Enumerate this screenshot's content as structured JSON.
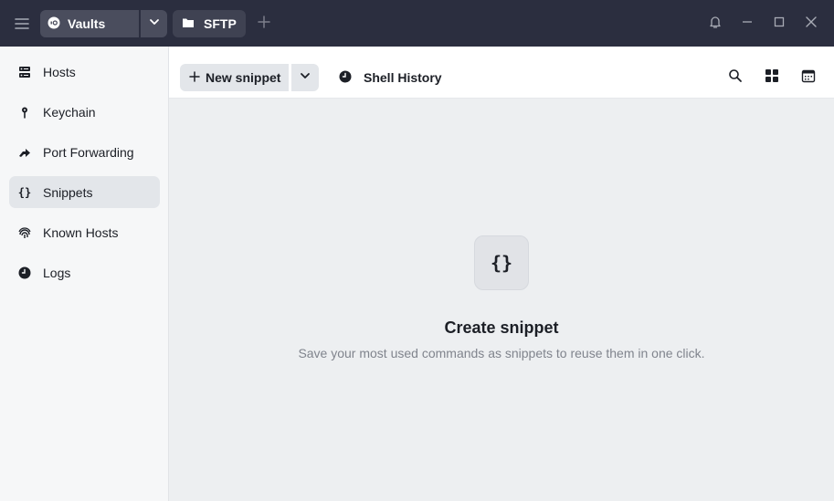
{
  "titlebar": {
    "vault_label": "Vaults",
    "tabs": [
      {
        "label": "SFTP"
      }
    ]
  },
  "sidebar": {
    "items": [
      {
        "label": "Hosts",
        "icon": "hosts-icon"
      },
      {
        "label": "Keychain",
        "icon": "key-icon"
      },
      {
        "label": "Port Forwarding",
        "icon": "port-forward-icon"
      },
      {
        "label": "Snippets",
        "icon": "braces-icon",
        "active": true
      },
      {
        "label": "Known Hosts",
        "icon": "fingerprint-icon"
      },
      {
        "label": "Logs",
        "icon": "clock-icon"
      }
    ]
  },
  "toolbar": {
    "new_snippet_label": "New snippet",
    "shell_history_label": "Shell History"
  },
  "empty_state": {
    "icon_glyph": "{}",
    "title": "Create snippet",
    "description": "Save your most used commands as snippets to reuse them in one click."
  },
  "colors": {
    "titlebar_bg": "#2b2e3f",
    "sidebar_bg": "#f6f7f8",
    "main_bg": "#edeff1",
    "active_item_bg": "#e3e6ea"
  }
}
